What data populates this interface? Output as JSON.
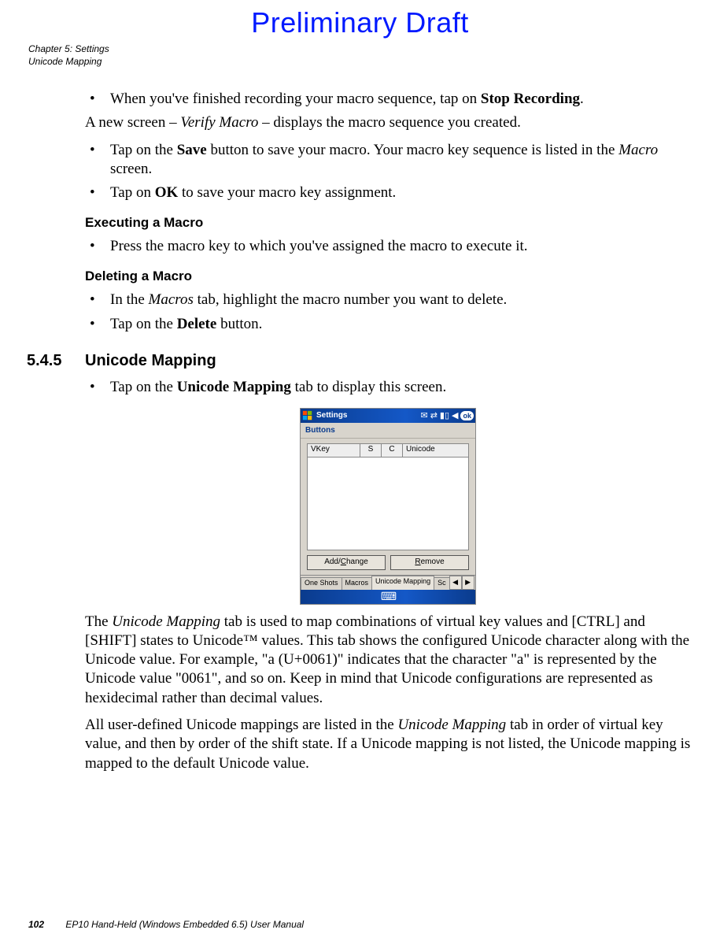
{
  "watermark": "Preliminary Draft",
  "header": {
    "line1": "Chapter 5: Settings",
    "line2": "Unicode Mapping"
  },
  "body": {
    "b1_pre": "When you've finished recording your macro sequence, tap on ",
    "b1_bold": "Stop Recording",
    "b1_post": ".",
    "p1_pre": "A new screen – ",
    "p1_em": "Verify Macro",
    "p1_post": " – displays the macro sequence you created.",
    "b2_pre": "Tap on the ",
    "b2_bold": "Save",
    "b2_mid": " button to save your macro. Your macro key sequence is listed in the ",
    "b2_em": "Macro",
    "b2_post": " screen.",
    "b3_pre": "Tap on ",
    "b3_bold": "OK",
    "b3_post": " to save your macro key assignment.",
    "h_exec": "Executing a Macro",
    "b4": "Press the macro key to which you've assigned the macro to execute it.",
    "h_del": "Deleting a Macro",
    "b5_pre": "In the ",
    "b5_em": "Macros",
    "b5_post": " tab, highlight the macro number you want to delete.",
    "b6_pre": "Tap on the ",
    "b6_bold": "Delete",
    "b6_post": " button.",
    "sec_num": "5.4.5",
    "sec_title": "Unicode Mapping",
    "b7_pre": "Tap on the ",
    "b7_bold": "Unicode Mapping",
    "b7_post": " tab to display this screen.",
    "p2_a": "The ",
    "p2_em1": "Unicode Mapping",
    "p2_b": " tab is used to map combinations of virtual key values and [CTRL] and [SHIFT] states to Unicode™ values. This tab shows the configured Unicode character along with the Unicode value. For example, \"a (U+0061)\" indicates that the character \"a\" is represented by the Unicode value \"0061\", and so on. Keep in mind that Unicode configura­tions are represented as hexidecimal rather than decimal values.",
    "p3_a": "All user-defined Unicode mappings are listed in the ",
    "p3_em1": "Unicode Mapping",
    "p3_b": " tab in order of virtual key value, and then by order of the shift state. If a Unicode mapping is not listed, the Unicode mapping is mapped to the default Unicode value."
  },
  "device": {
    "title": "Settings",
    "applet": "Buttons",
    "cols": {
      "vkey": "VKey",
      "s": "S",
      "c": "C",
      "unicode": "Unicode"
    },
    "btn_add_u": "C",
    "btn_add_rest": "hange",
    "btn_add_prefix": "Add/",
    "btn_remove_u": "R",
    "btn_remove_rest": "emove",
    "tabs": [
      "One Shots",
      "Macros",
      "Unicode Mapping",
      "Sc"
    ],
    "ok": "ok",
    "kbd_glyph": "⌨"
  },
  "footer": {
    "page": "102",
    "text": "EP10 Hand-Held (Windows Embedded 6.5) User Manual"
  }
}
